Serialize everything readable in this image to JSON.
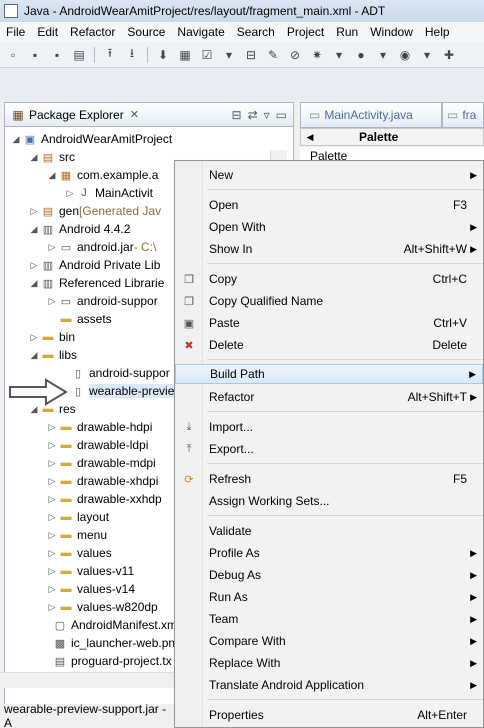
{
  "window": {
    "title": "Java - AndroidWearAmitProject/res/layout/fragment_main.xml - ADT"
  },
  "menubar": [
    "File",
    "Edit",
    "Refactor",
    "Source",
    "Navigate",
    "Search",
    "Project",
    "Run",
    "Window",
    "Help"
  ],
  "explorer": {
    "tab_title": "Package Explorer",
    "close": "✕",
    "rows": [
      {
        "label": "AndroidWearAmitProject",
        "suffix": "",
        "icon": "project-icon"
      },
      {
        "label": "src",
        "suffix": "",
        "icon": "source-folder-icon"
      },
      {
        "label": "com.example.a",
        "suffix": "",
        "icon": "package-icon"
      },
      {
        "label": "MainActivit",
        "suffix": "",
        "icon": "java-file-icon"
      },
      {
        "label": "gen",
        "suffix": " [Generated Jav",
        "icon": "source-folder-icon"
      },
      {
        "label": "Android 4.4.2",
        "suffix": "",
        "icon": "library-icon"
      },
      {
        "label": "android.jar",
        "suffix": " - C:\\",
        "icon": "jar-icon"
      },
      {
        "label": "Android Private Lib",
        "suffix": "",
        "icon": "library-icon"
      },
      {
        "label": "Referenced Librarie",
        "suffix": "",
        "icon": "library-icon"
      },
      {
        "label": "android-suppor",
        "suffix": "",
        "icon": "jar-icon"
      },
      {
        "label": "assets",
        "suffix": "",
        "icon": "folder-icon"
      },
      {
        "label": "bin",
        "suffix": "",
        "icon": "folder-icon"
      },
      {
        "label": "libs",
        "suffix": "",
        "icon": "folder-icon"
      },
      {
        "label": "android-suppor",
        "suffix": "",
        "icon": "jar-file-icon"
      },
      {
        "label": "wearable-previe",
        "suffix": "",
        "icon": "jar-file-icon"
      },
      {
        "label": "res",
        "suffix": "",
        "icon": "folder-icon"
      },
      {
        "label": "drawable-hdpi",
        "suffix": "",
        "icon": "folder-icon"
      },
      {
        "label": "drawable-ldpi",
        "suffix": "",
        "icon": "folder-icon"
      },
      {
        "label": "drawable-mdpi",
        "suffix": "",
        "icon": "folder-icon"
      },
      {
        "label": "drawable-xhdpi",
        "suffix": "",
        "icon": "folder-icon"
      },
      {
        "label": "drawable-xxhdp",
        "suffix": "",
        "icon": "folder-icon"
      },
      {
        "label": "layout",
        "suffix": "",
        "icon": "folder-icon"
      },
      {
        "label": "menu",
        "suffix": "",
        "icon": "folder-icon"
      },
      {
        "label": "values",
        "suffix": "",
        "icon": "folder-icon"
      },
      {
        "label": "values-v11",
        "suffix": "",
        "icon": "folder-icon"
      },
      {
        "label": "values-v14",
        "suffix": "",
        "icon": "folder-icon"
      },
      {
        "label": "values-w820dp",
        "suffix": "",
        "icon": "folder-icon"
      },
      {
        "label": "AndroidManifest.xm",
        "suffix": "",
        "icon": "xml-file-icon"
      },
      {
        "label": "ic_launcher-web.pn",
        "suffix": "",
        "icon": "image-file-icon"
      },
      {
        "label": "proguard-project.tx",
        "suffix": "",
        "icon": "text-file-icon"
      }
    ]
  },
  "status": {
    "text": "wearable-preview-support.jar - A"
  },
  "editor": {
    "tabs": [
      "MainActivity.java",
      "fra"
    ],
    "palette_title": "Palette",
    "palette_item": "Palette"
  },
  "context_menu": [
    {
      "label": "New",
      "shortcut": "",
      "submenu": true
    },
    {
      "label": "Open",
      "shortcut": "F3",
      "submenu": false
    },
    {
      "label": "Open With",
      "shortcut": "",
      "submenu": true
    },
    {
      "label": "Show In",
      "shortcut": "Alt+Shift+W",
      "submenu": true
    },
    {
      "label": "Copy",
      "shortcut": "Ctrl+C",
      "submenu": false,
      "icon": "copy-icon"
    },
    {
      "label": "Copy Qualified Name",
      "shortcut": "",
      "submenu": false,
      "icon": "copy-icon"
    },
    {
      "label": "Paste",
      "shortcut": "Ctrl+V",
      "submenu": false,
      "icon": "paste-icon"
    },
    {
      "label": "Delete",
      "shortcut": "Delete",
      "submenu": false,
      "icon": "delete-icon"
    },
    {
      "label": "Build Path",
      "shortcut": "",
      "submenu": true,
      "highlighted": true
    },
    {
      "label": "Refactor",
      "shortcut": "Alt+Shift+T",
      "submenu": true
    },
    {
      "label": "Import...",
      "shortcut": "",
      "submenu": false,
      "icon": "import-icon"
    },
    {
      "label": "Export...",
      "shortcut": "",
      "submenu": false,
      "icon": "export-icon"
    },
    {
      "label": "Refresh",
      "shortcut": "F5",
      "submenu": false,
      "icon": "refresh-icon"
    },
    {
      "label": "Assign Working Sets...",
      "shortcut": "",
      "submenu": false
    },
    {
      "label": "Validate",
      "shortcut": "",
      "submenu": false
    },
    {
      "label": "Profile As",
      "shortcut": "",
      "submenu": true
    },
    {
      "label": "Debug As",
      "shortcut": "",
      "submenu": true
    },
    {
      "label": "Run As",
      "shortcut": "",
      "submenu": true
    },
    {
      "label": "Team",
      "shortcut": "",
      "submenu": true
    },
    {
      "label": "Compare With",
      "shortcut": "",
      "submenu": true
    },
    {
      "label": "Replace With",
      "shortcut": "",
      "submenu": true
    },
    {
      "label": "Translate Android Application",
      "shortcut": "",
      "submenu": true
    },
    {
      "label": "Properties",
      "shortcut": "Alt+Enter",
      "submenu": false
    }
  ]
}
